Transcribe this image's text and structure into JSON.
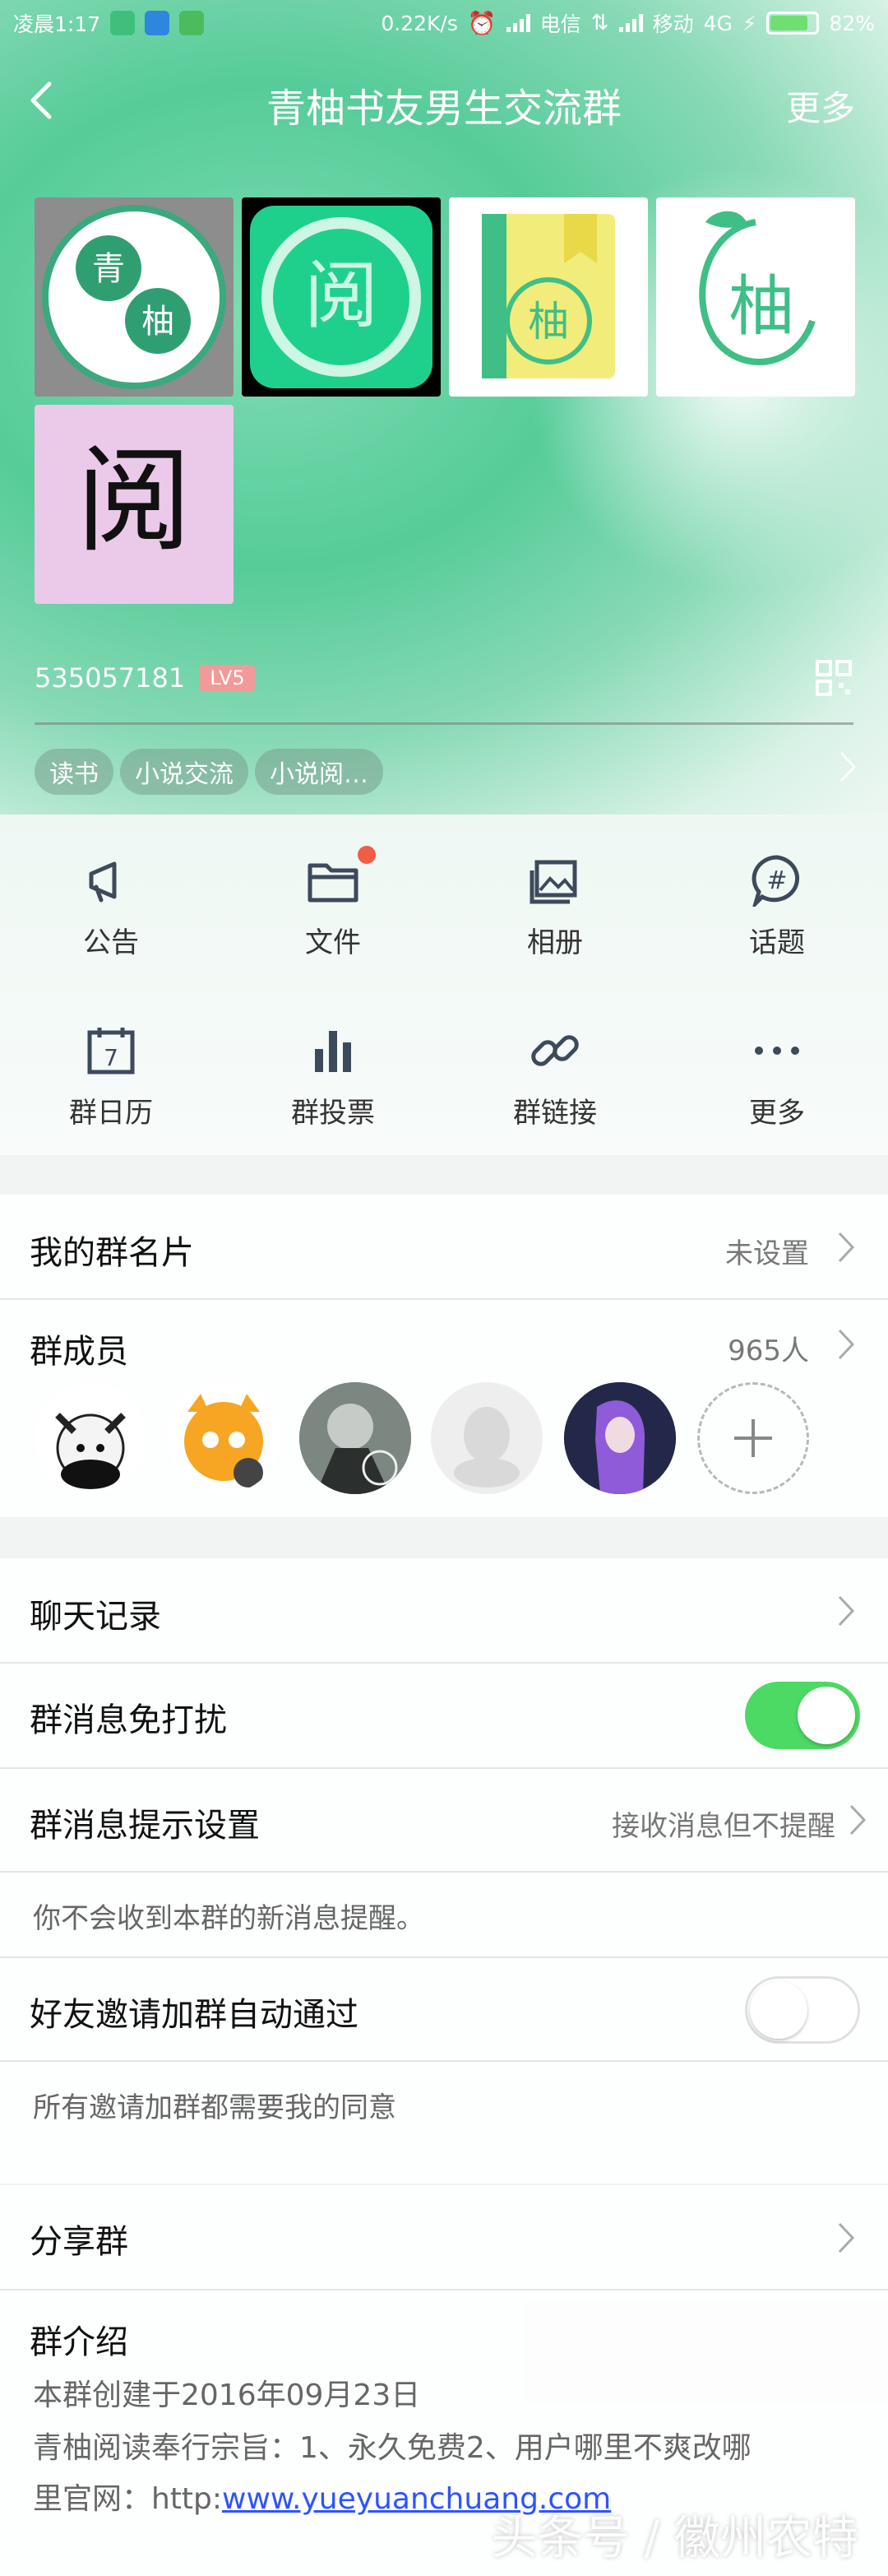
{
  "status_bar": {
    "time": "凌晨1:17",
    "speed": "0.22K/s",
    "carrier1": "电信",
    "carrier2": "移动",
    "network": "4G",
    "battery": "82%",
    "battery_level": 0.82
  },
  "navbar": {
    "title": "青柚书友男生交流群",
    "more": "更多"
  },
  "group": {
    "id": "535057181",
    "level": "LV5",
    "tags": [
      "读书",
      "小说交流",
      "小说阅…"
    ]
  },
  "avatars": {
    "a1_text1": "青",
    "a1_text2": "柚",
    "a2_text": "阅",
    "a3_text": "柚",
    "a4_text": "柚",
    "a5_text": "阅"
  },
  "features": [
    {
      "label": "公告",
      "icon": "megaphone-icon"
    },
    {
      "label": "文件",
      "icon": "folder-icon"
    },
    {
      "label": "相册",
      "icon": "album-icon"
    },
    {
      "label": "话题",
      "icon": "topic-icon"
    },
    {
      "label": "群日历",
      "icon": "calendar-icon"
    },
    {
      "label": "群投票",
      "icon": "vote-icon"
    },
    {
      "label": "群链接",
      "icon": "link-icon"
    },
    {
      "label": "更多",
      "icon": "more-icon"
    }
  ],
  "calendar_day": "7",
  "card": {
    "title": "我的群名片",
    "value": "未设置"
  },
  "members": {
    "title": "群成员",
    "count": "965人"
  },
  "chat_history": {
    "title": "聊天记录"
  },
  "mute": {
    "title": "群消息免打扰",
    "on": true
  },
  "notify": {
    "title": "群消息提示设置",
    "value": "接收消息但不提醒",
    "hint": "你不会收到本群的新消息提醒。"
  },
  "auto_join": {
    "title": "好友邀请加群自动通过",
    "on": false,
    "hint": "所有邀请加群都需要我的同意"
  },
  "share": {
    "title": "分享群"
  },
  "intro": {
    "title": "群介绍",
    "line1": "本群创建于2016年09月23日",
    "line2": "青柚阅读奉行宗旨：1、永久免费2、用户哪里不爽改哪",
    "line3_prefix": "里官网：http:",
    "line3_link": "www.yueyuanchuang.com"
  },
  "watermark": "头条号 / 徽州农特",
  "colors": {
    "accent": "#4cd964",
    "brand_green": "#3fbf86",
    "badge": "#f25d45"
  }
}
